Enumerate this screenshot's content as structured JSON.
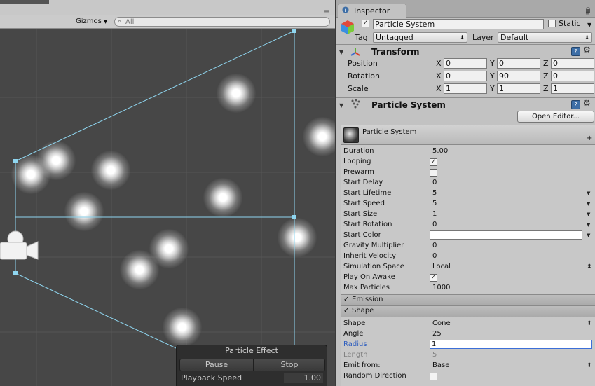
{
  "scene": {
    "gizmos_label": "Gizmos",
    "search_placeholder": "All"
  },
  "particle_effect": {
    "title": "Particle Effect",
    "pause_label": "Pause",
    "stop_label": "Stop",
    "playback_speed_label": "Playback Speed",
    "playback_speed_value": "1.00"
  },
  "inspector": {
    "tab_label": "Inspector",
    "object_name": "Particle System",
    "static_label": "Static",
    "tag_label": "Tag",
    "tag_value": "Untagged",
    "layer_label": "Layer",
    "layer_value": "Default"
  },
  "transform": {
    "title": "Transform",
    "axes": [
      "X",
      "Y",
      "Z"
    ],
    "rows": [
      {
        "label": "Position",
        "x": "0",
        "y": "0",
        "z": "0"
      },
      {
        "label": "Rotation",
        "x": "0",
        "y": "90",
        "z": "0"
      },
      {
        "label": "Scale",
        "x": "1",
        "y": "1",
        "z": "1"
      }
    ]
  },
  "particle_component": {
    "title": "Particle System",
    "open_editor_label": "Open Editor...",
    "header_title": "Particle System",
    "main_rows": [
      {
        "label": "Duration",
        "value": "5.00"
      },
      {
        "label": "Looping",
        "value": "✓"
      },
      {
        "label": "Prewarm",
        "value": ""
      },
      {
        "label": "Start Delay",
        "value": "0"
      },
      {
        "label": "Start Lifetime",
        "value": "5"
      },
      {
        "label": "Start Speed",
        "value": "5"
      },
      {
        "label": "Start Size",
        "value": "1"
      },
      {
        "label": "Start Rotation",
        "value": "0"
      },
      {
        "label": "Start Color",
        "value": ""
      },
      {
        "label": "Gravity Multiplier",
        "value": "0"
      },
      {
        "label": "Inherit Velocity",
        "value": "0"
      },
      {
        "label": "Simulation Space",
        "value": "Local"
      },
      {
        "label": "Play On Awake",
        "value": "✓"
      },
      {
        "label": "Max Particles",
        "value": "1000"
      }
    ],
    "emission_label": "Emission",
    "shape_label": "Shape",
    "shape_rows": [
      {
        "label": "Shape",
        "value": "Cone"
      },
      {
        "label": "Angle",
        "value": "25"
      },
      {
        "label": "Radius",
        "value": "1"
      },
      {
        "label": "Length",
        "value": "5"
      },
      {
        "label": "Emit from:",
        "value": "Base"
      },
      {
        "label": "Random Direction",
        "value": ""
      }
    ]
  },
  "colors": {
    "scene_bg": "#474747",
    "gizmo_line": "#8fd6f0",
    "inspector_bg": "#c2c2c2",
    "focus_blue": "#3c6fd8"
  }
}
